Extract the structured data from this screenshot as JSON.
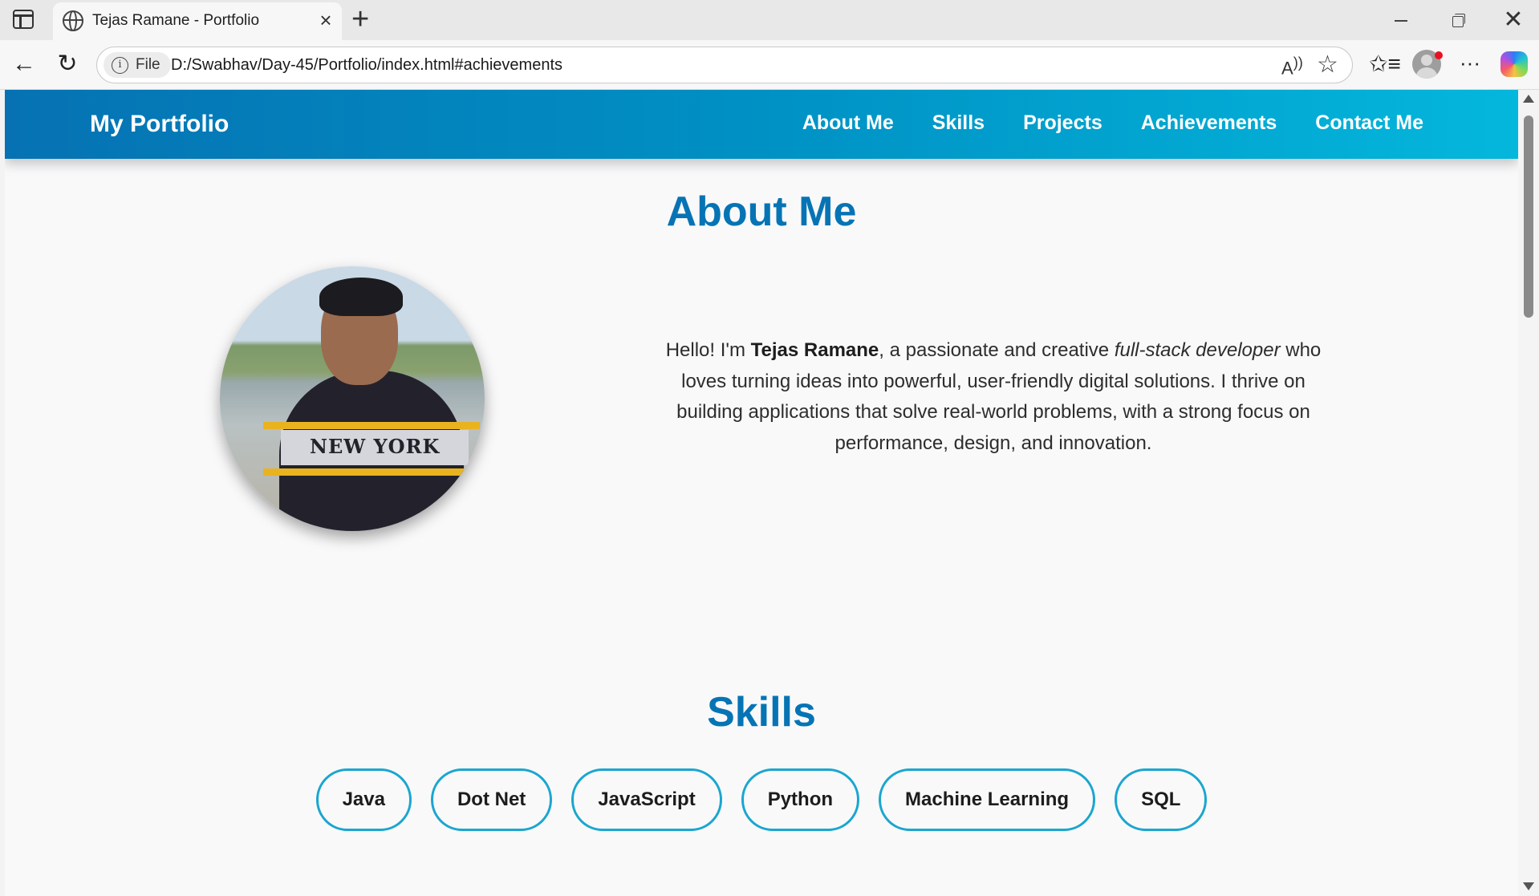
{
  "browser": {
    "tab_title": "Tejas Ramane - Portfolio",
    "tab_close_glyph": "×",
    "new_tab_glyph": "+",
    "site_chip_label": "File",
    "url": "D:/Swabhav/Day-45/Portfolio/index.html#achievements",
    "icons": [
      "sidebar-icon",
      "globe-icon",
      "back-arrow-icon",
      "reload-icon",
      "info-icon",
      "read-aloud-icon",
      "star-icon",
      "favorites-icon",
      "profile-icon",
      "more-icon",
      "copilot-icon"
    ]
  },
  "site": {
    "brand": "My Portfolio",
    "nav": [
      "About Me",
      "Skills",
      "Projects",
      "Achievements",
      "Contact Me"
    ],
    "colors": {
      "nav_gradient_start": "#0672b3",
      "nav_gradient_end": "#04b7dc",
      "heading": "#0674b4",
      "skill_border": "#1aa6cf"
    }
  },
  "about": {
    "heading": "About Me",
    "photo_shirt_text": "NEW YORK",
    "text_before": "Hello! I'm ",
    "name": "Tejas Ramane",
    "text_middle": ", a passionate and creative ",
    "role": "full-stack developer",
    "text_after": " who loves turning ideas into powerful, user-friendly digital solutions. I thrive on building applications that solve real-world problems, with a strong focus on performance, design, and innovation."
  },
  "skills": {
    "heading": "Skills",
    "items": [
      "Java",
      "Dot Net",
      "JavaScript",
      "Python",
      "Machine Learning",
      "SQL"
    ]
  }
}
